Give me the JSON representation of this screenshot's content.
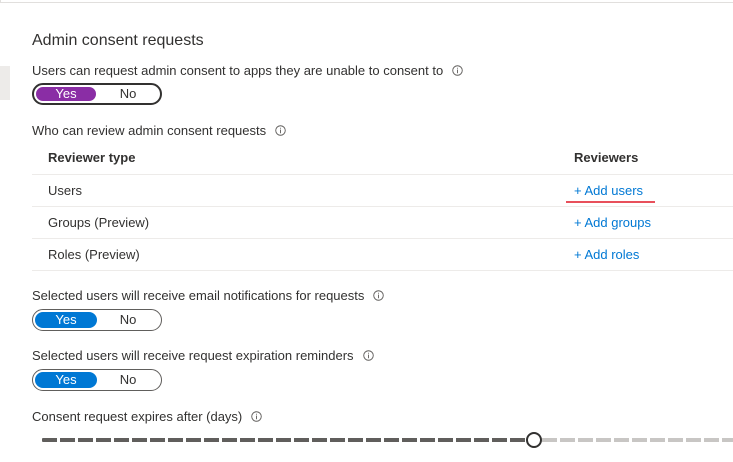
{
  "section": {
    "title": "Admin consent requests"
  },
  "request_consent": {
    "label": "Users can request admin consent to apps they are unable to consent to",
    "yes_label": "Yes",
    "no_label": "No",
    "selected": "Yes"
  },
  "reviewers": {
    "label": "Who can review admin consent requests",
    "columns": {
      "type": "Reviewer type",
      "reviewers": "Reviewers"
    },
    "rows": [
      {
        "type": "Users",
        "action": "+ Add users"
      },
      {
        "type": "Groups (Preview)",
        "action": "+ Add groups"
      },
      {
        "type": "Roles (Preview)",
        "action": "+ Add roles"
      }
    ]
  },
  "email_notifications": {
    "label": "Selected users will receive email notifications for requests",
    "yes_label": "Yes",
    "no_label": "No",
    "selected": "Yes"
  },
  "expiration_reminders": {
    "label": "Selected users will receive request expiration reminders",
    "yes_label": "Yes",
    "no_label": "No",
    "selected": "Yes"
  },
  "expiry": {
    "label": "Consent request expires after (days)",
    "slider_fraction": 0.71
  },
  "colors": {
    "accent": "#0078d4",
    "toggle_focus": "#8a2da5",
    "focus_underline": "#e8505b"
  },
  "icons": {
    "info": "info-icon"
  }
}
